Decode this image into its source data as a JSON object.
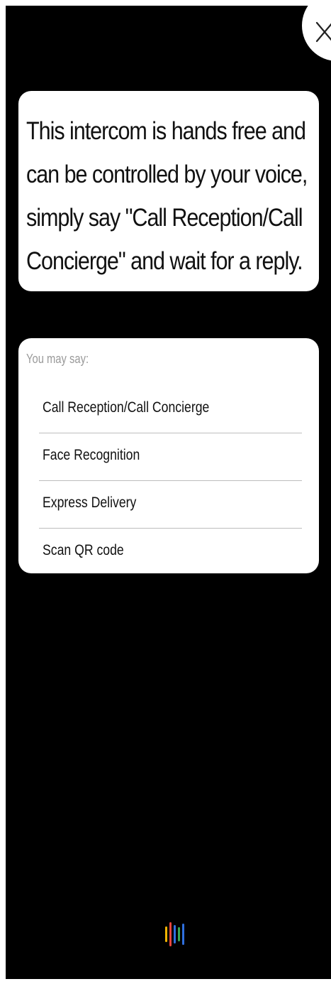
{
  "close_button": {
    "icon": "close-icon"
  },
  "intro": {
    "text": "This intercom is hands free and can be controlled by your voice, simply say \"Call Reception/Call Concierge\" and wait for a reply."
  },
  "suggestions": {
    "label": "You may say:",
    "items": [
      {
        "label": "Call Reception/Call Concierge"
      },
      {
        "label": "Face Recognition"
      },
      {
        "label": "Express Delivery"
      },
      {
        "label": "Scan QR code"
      }
    ]
  },
  "voice_indicator": {
    "icon": "voice-waveform-icon",
    "colors": [
      "#F5B400",
      "#E8453C",
      "#2F6FDE",
      "#35A853",
      "#2F6FDE"
    ]
  }
}
